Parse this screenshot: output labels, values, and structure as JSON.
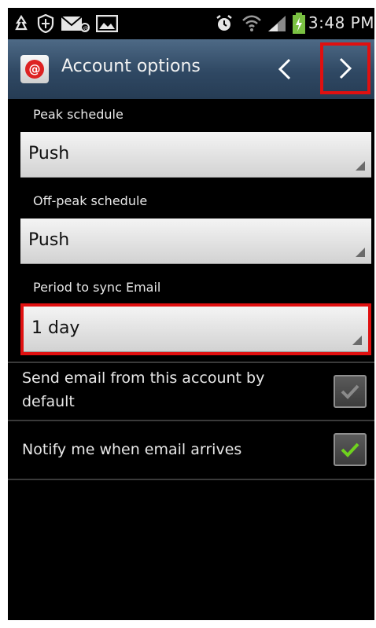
{
  "status_bar": {
    "time": "3:48 PM",
    "icons": [
      "recycle-icon",
      "shield-icon",
      "missed-email-icon",
      "image-icon",
      "alarm-icon",
      "wifi-icon",
      "signal-icon",
      "battery-charging-icon"
    ]
  },
  "action_bar": {
    "title": "Account options",
    "app_icon": "email-app-icon",
    "prev_icon": "chevron-left-icon",
    "next_icon": "chevron-right-icon"
  },
  "settings": {
    "peak_schedule": {
      "label": "Peak schedule",
      "value": "Push"
    },
    "off_peak_schedule": {
      "label": "Off-peak schedule",
      "value": "Push"
    },
    "sync_period": {
      "label": "Period to sync Email",
      "value": "1 day"
    },
    "default_account": {
      "label": "Send email from this account by default",
      "checked": false
    },
    "notify": {
      "label": "Notify me when email arrives",
      "checked": true
    }
  },
  "colors": {
    "highlight": "#e01010",
    "action_bar": "#2f4863",
    "check_green": "#6fd21e"
  }
}
